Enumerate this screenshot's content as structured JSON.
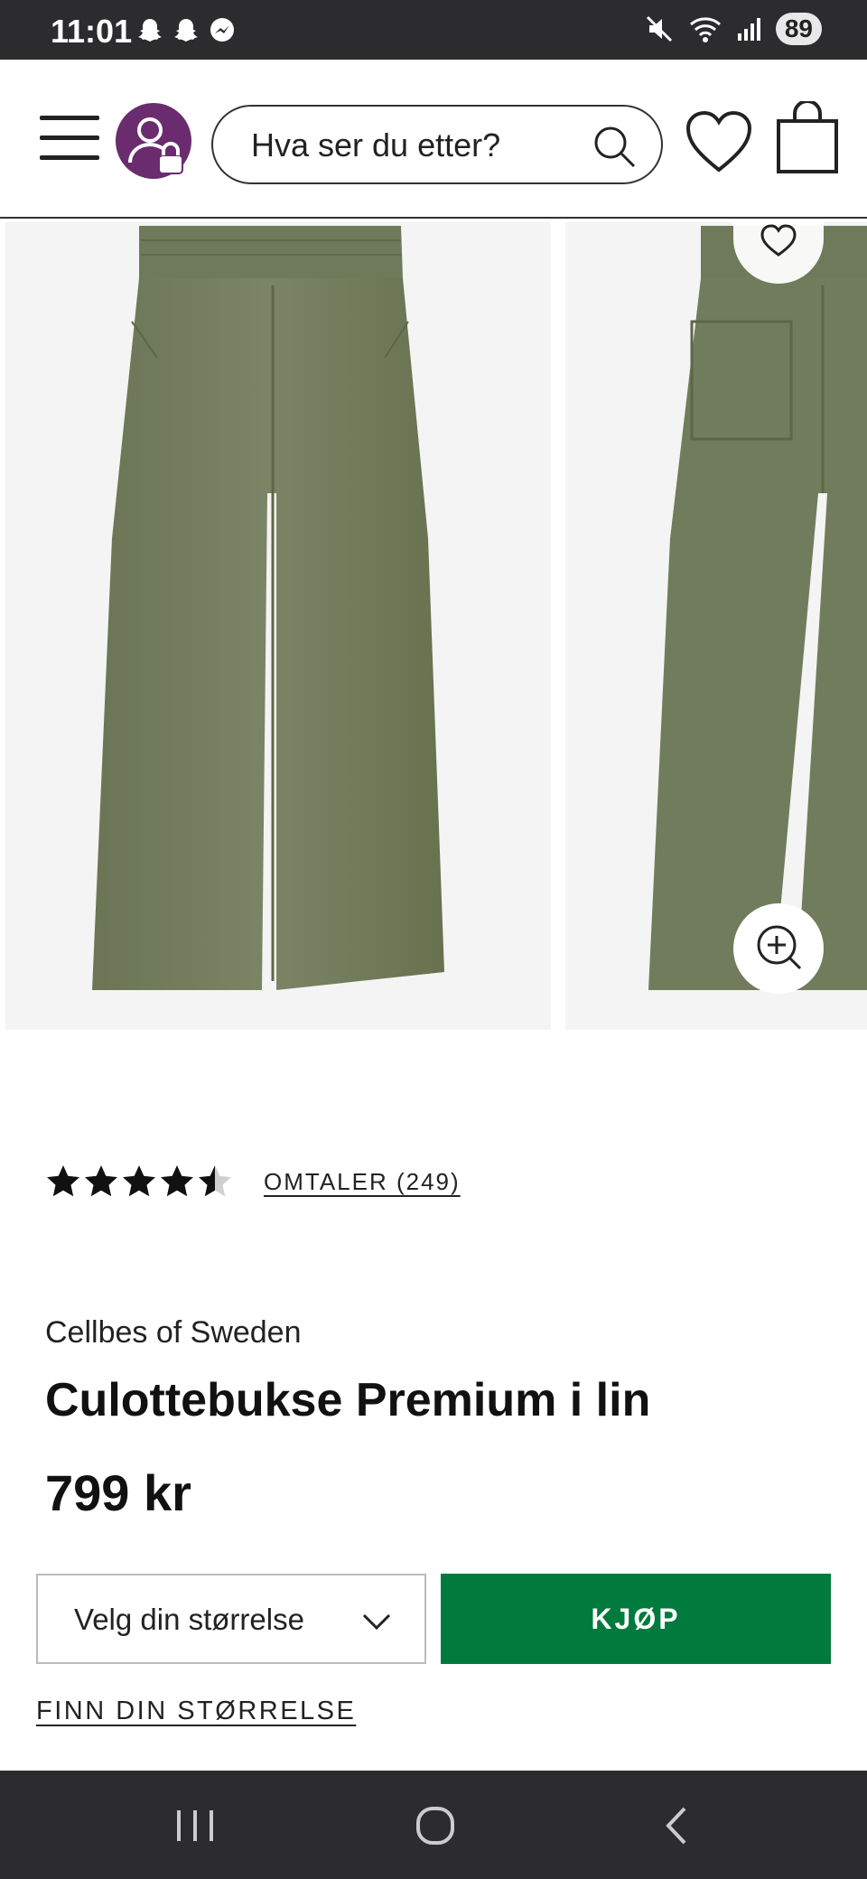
{
  "status_bar": {
    "time": "11:01",
    "battery": "89",
    "left_icons": [
      "snapchat-icon",
      "snapchat-icon",
      "messenger-icon"
    ],
    "right_icons": [
      "mute-icon",
      "wifi-icon",
      "signal-icon"
    ]
  },
  "header": {
    "search_placeholder": "Hva ser du etter?",
    "brand_color": "#6a2c6e"
  },
  "product": {
    "rating": 4.5,
    "rating_max": 5,
    "reviews_label": "OMTALER (249)",
    "brand": "Cellbes of Sweden",
    "title": "Culottebukse Premium i lin",
    "price": "799 kr",
    "size_select_label": "Velg din størrelse",
    "buy_label": "KJØP",
    "find_size_label": "FINN DIN STØRRELSE",
    "buy_color": "#017a3d",
    "gallery": [
      {
        "view": "front",
        "color": "olive green linen"
      },
      {
        "view": "back",
        "color": "olive green linen"
      }
    ]
  },
  "nav_bar": {
    "buttons": [
      "recent-apps-icon",
      "home-icon",
      "back-icon"
    ]
  }
}
